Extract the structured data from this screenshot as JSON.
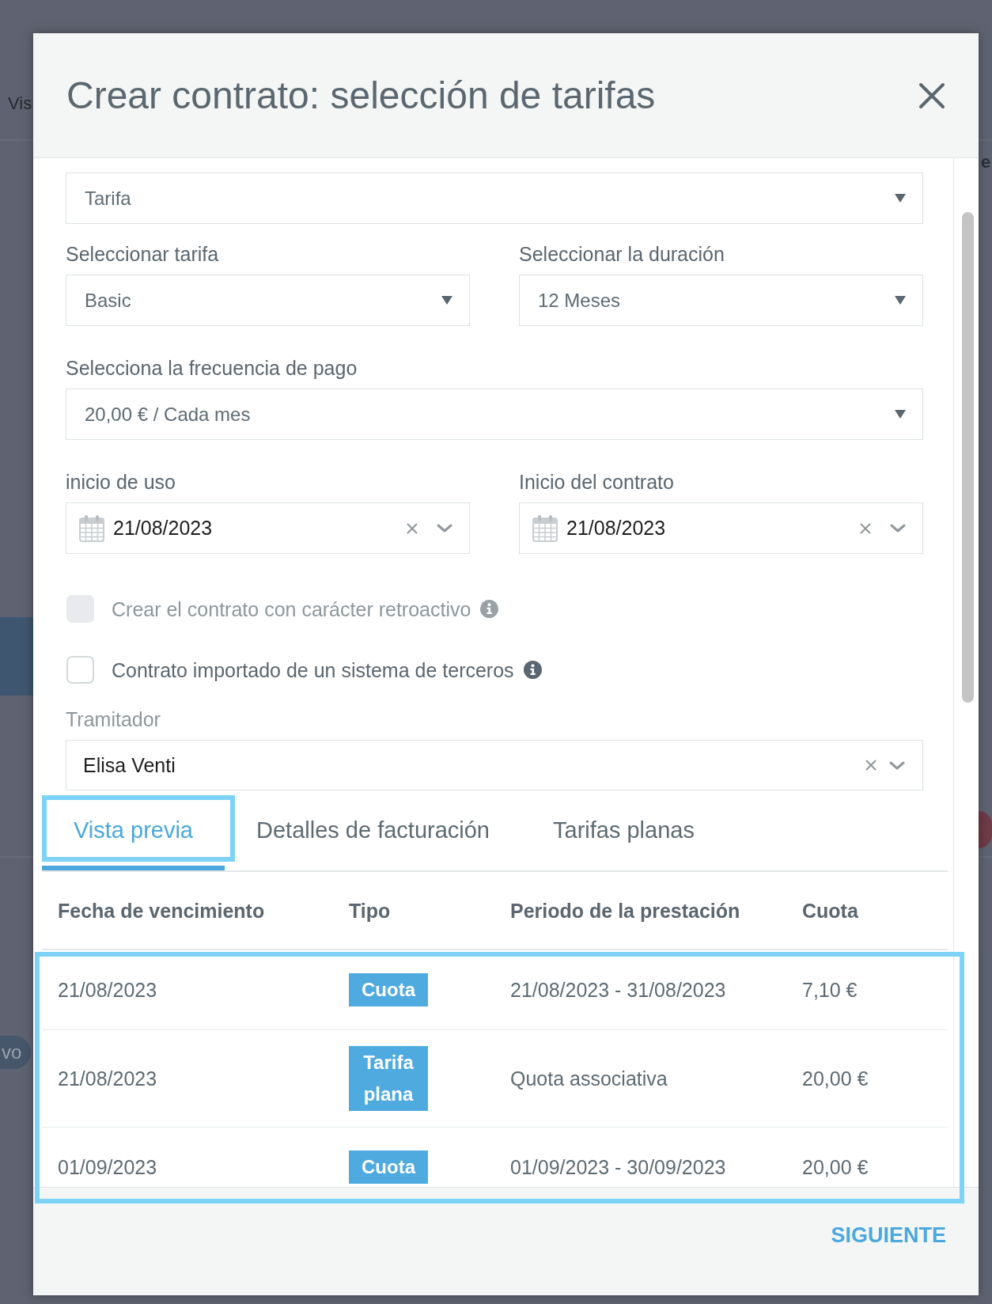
{
  "background": {
    "nav_text": "Vis",
    "pill_text": "vo",
    "side_text": "e"
  },
  "dialog": {
    "title": "Crear contrato: selección de tarifas"
  },
  "form": {
    "rows": [
      {
        "fields": [
          {
            "kind": "select",
            "value": "Tarifa"
          }
        ]
      },
      {
        "fields": [
          {
            "kind": "select",
            "label": "Seleccionar tarifa",
            "value": "Basic"
          },
          {
            "kind": "select",
            "label": "Seleccionar la duración",
            "value": "12 Meses"
          }
        ]
      },
      {
        "fields": [
          {
            "kind": "select",
            "label": "Selecciona la frecuencia de pago",
            "value": "20,00 € / Cada mes"
          }
        ]
      },
      {
        "fields": [
          {
            "kind": "date",
            "label": "inicio de uso",
            "value": "21/08/2023"
          },
          {
            "kind": "date",
            "label": "Inicio del contrato",
            "value": "21/08/2023"
          }
        ]
      },
      {
        "fields": [
          {
            "kind": "checkbox",
            "label": "Crear el contrato con carácter retroactivo",
            "checked": false,
            "disabled": true
          }
        ]
      },
      {
        "fields": [
          {
            "kind": "checkbox",
            "label": "Contrato importado de un sistema de terceros",
            "checked": false,
            "disabled": false
          }
        ]
      },
      {
        "fields": [
          {
            "kind": "combo",
            "label": "Tramitador",
            "value": "Elisa Venti"
          }
        ]
      }
    ]
  },
  "tabs": [
    {
      "label": "Vista previa",
      "selected": true,
      "highlighted": true
    },
    {
      "label": "Detalles de facturación",
      "selected": false,
      "highlighted": false
    },
    {
      "label": "Tarifas planas",
      "selected": false,
      "highlighted": false
    }
  ],
  "table": {
    "highlighted": true,
    "columns": [
      "Fecha de vencimiento",
      "Tipo",
      "Periodo de la prestación",
      "Cuota"
    ],
    "rows": [
      {
        "due_date": "21/08/2023",
        "type": "Cuota",
        "period": "21/08/2023 - 31/08/2023",
        "amount": "7,10 €"
      },
      {
        "due_date": "21/08/2023",
        "type": "Tarifa plana",
        "period": "Quota associativa",
        "amount": "20,00 €"
      },
      {
        "due_date": "01/09/2023",
        "type": "Cuota",
        "period": "01/09/2023 - 30/09/2023",
        "amount": "20,00 €"
      }
    ]
  },
  "footer": {
    "next_button": "SIGUIENTE"
  }
}
